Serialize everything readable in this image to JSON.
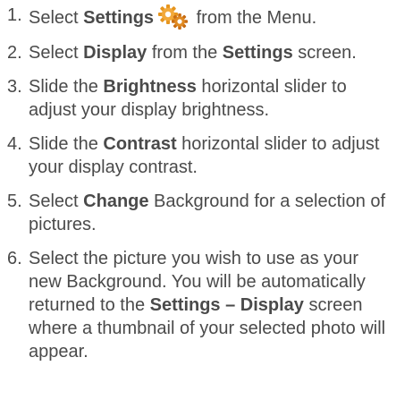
{
  "steps": [
    {
      "number": "1.",
      "parts": [
        {
          "text": "Select ",
          "bold": false
        },
        {
          "text": "Settings",
          "bold": true
        },
        {
          "icon": "settings-gear-icon"
        },
        {
          "text": " from the Menu.",
          "bold": false
        }
      ]
    },
    {
      "number": "2.",
      "parts": [
        {
          "text": "Select ",
          "bold": false
        },
        {
          "text": "Display",
          "bold": true
        },
        {
          "text": " from the ",
          "bold": false
        },
        {
          "text": "Settings",
          "bold": true
        },
        {
          "text": " screen.",
          "bold": false
        }
      ]
    },
    {
      "number": "3.",
      "parts": [
        {
          "text": "Slide the ",
          "bold": false
        },
        {
          "text": "Brightness",
          "bold": true
        },
        {
          "text": " horizontal slider to adjust your display brightness.",
          "bold": false
        }
      ]
    },
    {
      "number": "4.",
      "parts": [
        {
          "text": "Slide the ",
          "bold": false
        },
        {
          "text": "Contrast",
          "bold": true
        },
        {
          "text": " horizontal slider to adjust your display contrast.",
          "bold": false
        }
      ]
    },
    {
      "number": "5.",
      "parts": [
        {
          "text": "Select ",
          "bold": false
        },
        {
          "text": "Change",
          "bold": true
        },
        {
          "text": " Background for a selection of pictures.",
          "bold": false
        }
      ]
    },
    {
      "number": "6.",
      "parts": [
        {
          "text": "Select the picture you wish to use as your new Background. You will be automatically returned to the ",
          "bold": false
        },
        {
          "text": "Settings – Display",
          "bold": true
        },
        {
          "text": " screen where a thumbnail of your selected photo will appear.",
          "bold": false
        }
      ]
    }
  ],
  "colors": {
    "text": "#4a4a4a",
    "gear_primary": "#f0a020",
    "gear_secondary": "#d7771a"
  }
}
